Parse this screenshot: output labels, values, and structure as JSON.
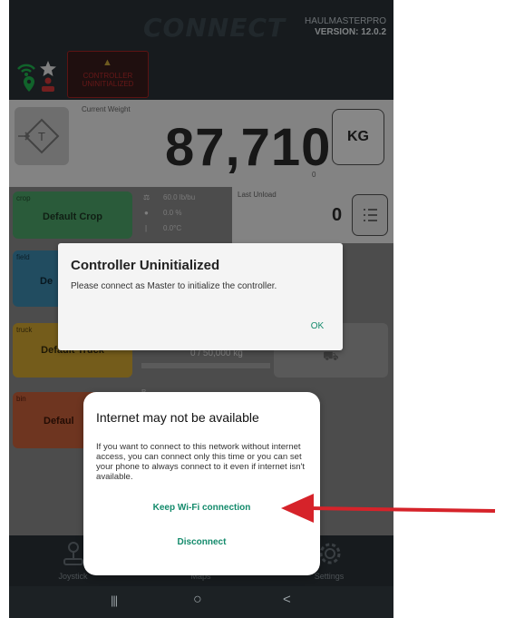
{
  "header": {
    "logo": "CONNECT",
    "app_name": "HAULMASTERPRO",
    "version": "VERSION: 12.0.2"
  },
  "warning": {
    "text": "CONTROLLER UNINITIALIZED"
  },
  "weight": {
    "label": "Current Weight",
    "value": "87,710",
    "unit": "KG",
    "sub": "0",
    "tare_label": "T"
  },
  "crop": {
    "label": "crop",
    "name": "Default Crop",
    "test_weight": "60.0 lb/bu",
    "moisture": "0.0 %",
    "temp": "0.0°C"
  },
  "unload": {
    "label": "Last Unload",
    "value": "0"
  },
  "field": {
    "label": "field",
    "name": "De"
  },
  "truck": {
    "label": "truck",
    "name": "Default Truck",
    "progress_text": "0 / 50,000  kg"
  },
  "bin": {
    "label": "bin",
    "name": "Defaul",
    "partial": "B"
  },
  "bottom_tabs": {
    "joystick": "Joystick",
    "maps": "Maps",
    "settings": "Settings"
  },
  "dialog1": {
    "title": "Controller Uninitialized",
    "message": "Please connect as Master to initialize the controller.",
    "ok": "OK"
  },
  "dialog2": {
    "title": "Internet may not be available",
    "message": "If you want to connect to this network without internet access, you can connect only this time or you can set your phone to always connect to it even if internet isn't available.",
    "keep": "Keep Wi-Fi connection",
    "disconnect": "Disconnect"
  },
  "navbar": {
    "recents": "|||",
    "home": "○",
    "back": "<"
  },
  "colors": {
    "crop_green": "#4ea66a",
    "field_blue": "#3d8ab0",
    "truck_yellow": "#d4a832",
    "bin_orange": "#c9613b",
    "accent_teal": "#138a6b",
    "arrow_red": "#d6232a"
  }
}
